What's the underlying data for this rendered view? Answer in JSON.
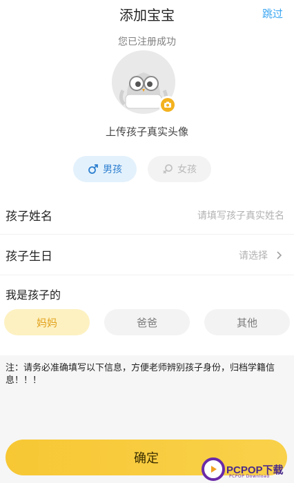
{
  "header": {
    "title": "添加宝宝",
    "skip_label": "跳过"
  },
  "subtitle": "您已注册成功",
  "avatar": {
    "upload_label": "上传孩子真实头像"
  },
  "gender": {
    "male_label": "男孩",
    "female_label": "女孩",
    "selected": "male"
  },
  "form": {
    "name_label": "孩子姓名",
    "name_placeholder": "请填写孩子真实姓名",
    "birthday_label": "孩子生日",
    "birthday_placeholder": "请选择"
  },
  "relation": {
    "title": "我是孩子的",
    "options": [
      "妈妈",
      "爸爸",
      "其他"
    ],
    "selected": "妈妈"
  },
  "note": "注：请务必准确填写以下信息，方便老师辨别孩子身份，归档学籍信息！！！",
  "confirm_label": "确定",
  "watermark": {
    "brand": "PCPOP下载",
    "sub": "PCPOP Download"
  },
  "colors": {
    "accent_blue": "#3aa6f2",
    "accent_yellow": "#f7c734",
    "selected_male_bg": "#e3f1fc",
    "selected_mom_bg": "#fdf1c2"
  },
  "icons": {
    "male": "male-symbol-icon",
    "female": "female-symbol-icon",
    "camera": "camera-icon",
    "chevron": "chevron-right-icon"
  }
}
